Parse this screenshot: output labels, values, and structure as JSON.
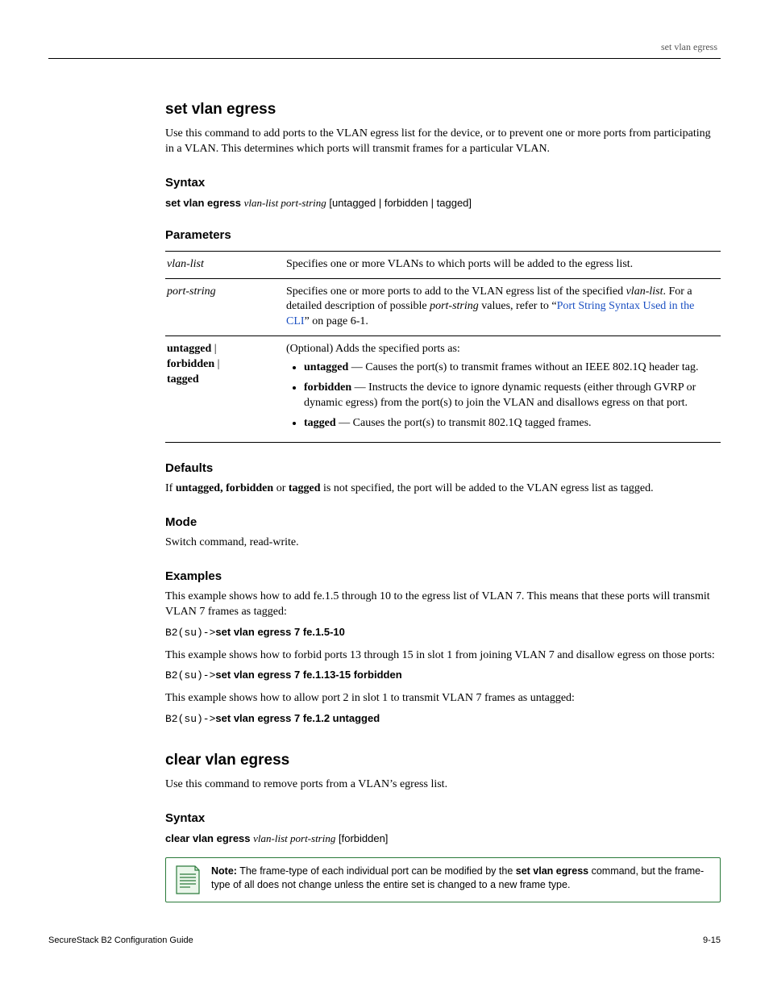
{
  "header": {
    "right": "set vlan egress"
  },
  "cmd1": {
    "title": "set vlan egress",
    "intro": "Use this command to add ports to the VLAN egress list for the device, or to prevent one or more ports from participating in a VLAN. This determines which ports will transmit frames for a particular VLAN.",
    "syntax_h": "Syntax",
    "syntax_kw": "set vlan egress",
    "syntax_args": "vlan-list port-string",
    "syntax_opt": "[untagged | forbidden | tagged]",
    "params_h": "Parameters",
    "row1_l": "vlan-list",
    "row1_r": "Specifies one or more VLANs to which ports will be added to the egress list.",
    "row2_l": "port-string",
    "row2_r_pre": "Specifies one or more ports to add to the VLAN egress list of the specified ",
    "row2_r_i1": "vlan-list",
    "row2_r_mid1": ". For a detailed description of possible ",
    "row2_r_i2": "port-string",
    "row2_r_mid2": " values, refer to “",
    "row2_link": "Port String Syntax Used in the CLI",
    "row2_after": "” on page 6-1.",
    "row3_l1": "untagged",
    "row3_l2": "forbidden",
    "row3_l3": "tagged",
    "row3_intro": "(Optional) Adds the specified ports as:",
    "row3_b1_k": "untagged",
    "row3_b1_t": " — Causes the port(s) to transmit frames without an IEEE 802.1Q header tag.",
    "row3_b2_k": "forbidden",
    "row3_b2_t": " — Instructs the device to ignore dynamic requests (either through GVRP or dynamic egress) from the port(s) to join the VLAN and disallows egress on that port.",
    "row3_b3_k": "tagged",
    "row3_b3_t": " — Causes the port(s) to transmit 802.1Q tagged frames.",
    "defaults_h": "Defaults",
    "defaults_pre": "If ",
    "defaults_k": "untagged, forbidden",
    "defaults_or": " or ",
    "defaults_k2": "tagged",
    "defaults_post": " is not specified, the port will be added to the VLAN egress list as tagged.",
    "mode_h": "Mode",
    "mode_t": "Switch command, read-write.",
    "examples_h": "Examples",
    "ex1_t": "This example shows how to add fe.1.5 through 10 to the egress list of VLAN 7. This means that these ports will transmit VLAN 7 frames as tagged:",
    "ex1_prompt": "B2(su)->",
    "ex1_cmd": "set vlan egress 7 fe.1.5-10",
    "ex2_t": "This example shows how to forbid ports 13 through 15 in slot 1 from joining VLAN 7 and disallow egress on those ports:",
    "ex2_prompt": "B2(su)->",
    "ex2_cmd": "set vlan egress 7 fe.1.13-15 forbidden",
    "ex3_t": "This example shows how to allow port 2 in slot 1 to transmit VLAN 7 frames as untagged:",
    "ex3_prompt": "B2(su)->",
    "ex3_cmd": "set vlan egress 7 fe.1.2 untagged"
  },
  "cmd2": {
    "title": "clear vlan egress",
    "intro": "Use this command to remove ports from a VLAN’s egress list.",
    "syntax_h": "Syntax",
    "syntax_kw": "clear vlan egress",
    "syntax_args": "vlan-list port-string",
    "syntax_opt": "[forbidden]",
    "note_label": "Note:",
    "note_text": " The frame-type of each individual port can be modified by the ",
    "note_b": "set vlan egress",
    "note_post": " command, but the frame-type of all does not change unless the entire set is changed to a new frame type."
  },
  "footer": {
    "left": "SecureStack B2 Configuration Guide",
    "right": "9-15"
  }
}
